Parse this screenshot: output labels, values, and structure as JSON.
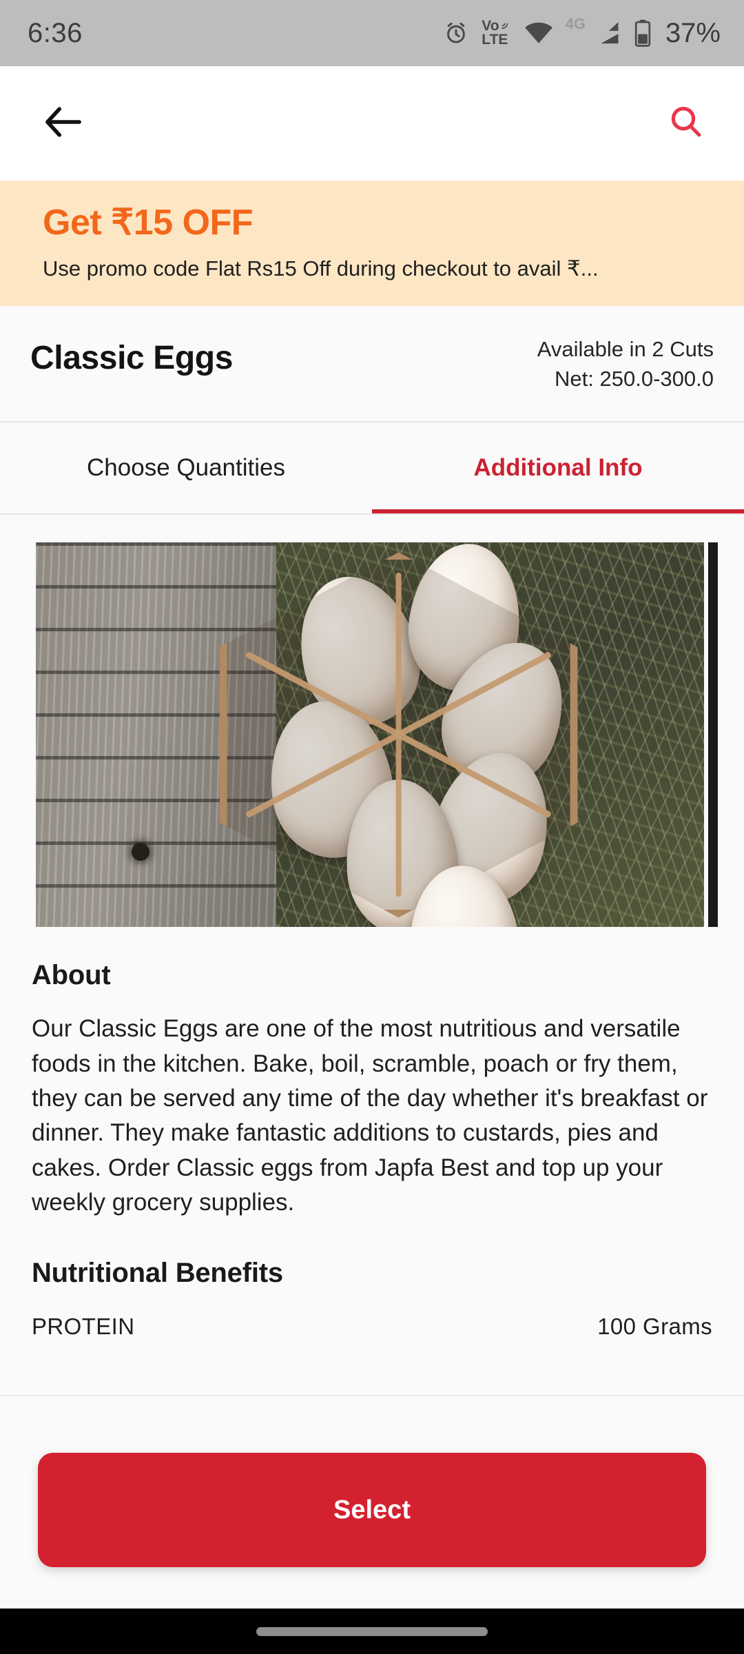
{
  "status_bar": {
    "time": "6:36",
    "battery_percent": "37%",
    "network_label": "4G",
    "volte_top": "Vo",
    "volte_bottom": "LTE",
    "icons": [
      "alarm-clock-icon",
      "volte-icon",
      "wifi-icon",
      "cellular-signal-icon",
      "battery-icon"
    ]
  },
  "app_bar": {
    "back_label": "back-arrow-icon",
    "search_label": "search-icon",
    "search_color": "#e8374a"
  },
  "promo": {
    "title": "Get ₹15 OFF",
    "subtitle": "Use promo code Flat Rs15 Off  during checkout to avail ₹...",
    "background": "#fce6c4",
    "title_color": "#f2671a"
  },
  "product": {
    "name": "Classic Eggs",
    "availability": "Available in 2 Cuts",
    "net_weight": "Net: 250.0-300.0"
  },
  "tabs": [
    {
      "label": "Choose Quantities",
      "active": false
    },
    {
      "label": "Additional Info",
      "active": true
    }
  ],
  "tab_accent_color": "#cc2131",
  "gallery": {
    "image_alt": "classic-eggs-in-basket-photo"
  },
  "about": {
    "heading": "About",
    "body": "Our Classic Eggs are one of the most nutritious and versatile foods in the kitchen. Bake, boil, scramble, poach or fry them, they can be served any time of the day whether it's breakfast or dinner. They make fantastic additions to custards, pies and cakes. Order Classic eggs from Japfa Best and top up your weekly grocery supplies."
  },
  "nutrition": {
    "heading": "Nutritional Benefits",
    "rows": [
      {
        "name": "PROTEIN",
        "value": "100 Grams"
      }
    ]
  },
  "footer": {
    "select_label": "Select",
    "select_color": "#d4212f"
  }
}
